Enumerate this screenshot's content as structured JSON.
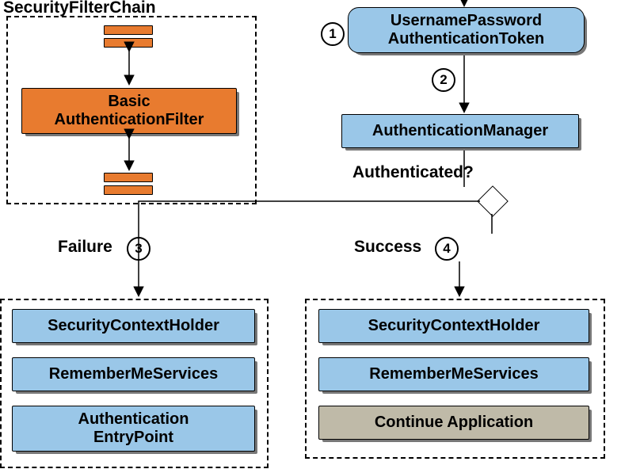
{
  "title": "SecurityFilterChain",
  "markers": {
    "m1": "1",
    "m2": "2",
    "m3": "3",
    "m4": "4"
  },
  "filter": {
    "line1": "Basic",
    "line2": "AuthenticationFilter"
  },
  "token": {
    "line1": "UsernamePassword",
    "line2": "AuthenticationToken"
  },
  "manager": "AuthenticationManager",
  "question": "Authenticated?",
  "failureLabel": "Failure",
  "successLabel": "Success",
  "failure": {
    "a": "SecurityContextHolder",
    "b": "RememberMeServices",
    "c1": "Authentication",
    "c2": "EntryPoint"
  },
  "success": {
    "a": "SecurityContextHolder",
    "b": "RememberMeServices",
    "c": "Continue Application"
  }
}
